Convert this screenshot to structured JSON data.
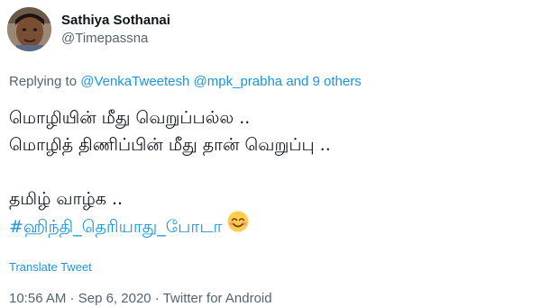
{
  "author": {
    "display_name": "Sathiya Sothanai",
    "handle": "@Timepassna"
  },
  "replying": {
    "prefix": "Replying to ",
    "mention1": "@VenkaTweetesh",
    "mention2": "@mpk_prabha",
    "suffix_and": " and ",
    "others": "9 others"
  },
  "tweet": {
    "line1": "மொழியின் மீது வெறுப்பல்ல  ..",
    "line2": "மொழித் திணிப்பின் மீது தான் வெறுப்பு ..",
    "line3": "தமிழ் வாழ்க  ..",
    "hashtag": "#ஹிந்தி_தெரியாது_போடா",
    "emoji_icon": "smiling-face-with-smiling-eyes"
  },
  "translate_label": "Translate Tweet",
  "meta": {
    "time": "10:56 AM",
    "separator": " · ",
    "date": "Sep 6, 2020",
    "source": "Twitter for Android"
  },
  "colors": {
    "link": "#1b95e0",
    "secondary_text": "#536471",
    "primary_text": "#0f1419"
  }
}
